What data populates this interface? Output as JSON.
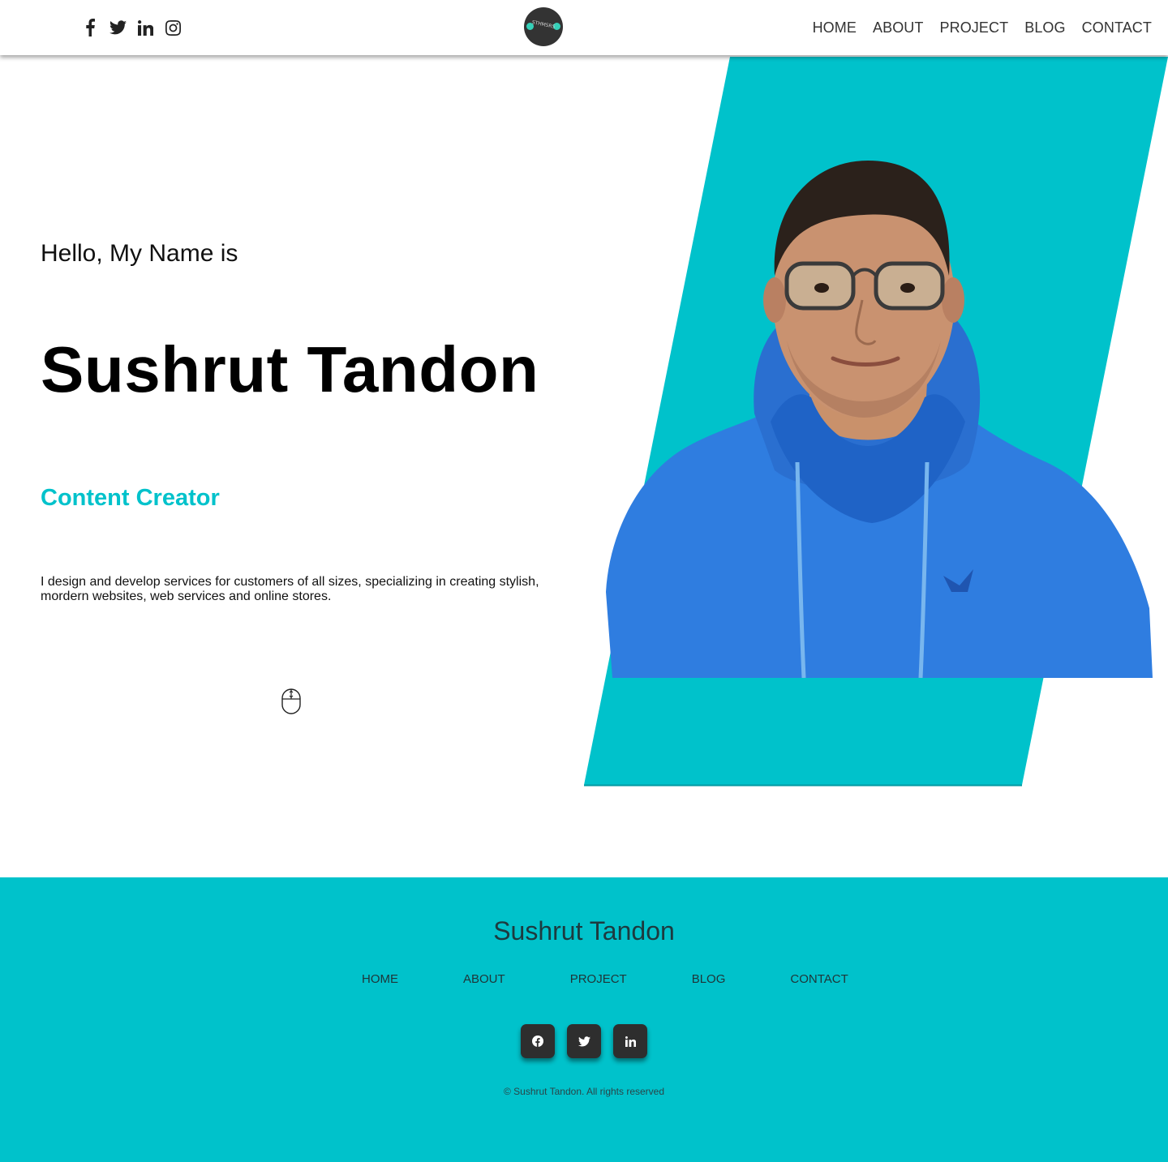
{
  "header": {
    "social": [
      {
        "icon": "facebook-icon"
      },
      {
        "icon": "twitter-icon"
      },
      {
        "icon": "linkedin-icon"
      },
      {
        "icon": "instagram-icon"
      }
    ],
    "logo_text": "STHMSRS",
    "nav": [
      "HOME",
      "ABOUT",
      "PROJECT",
      "BLOG",
      "CONTACT"
    ]
  },
  "hero": {
    "greeting": "Hello, My Name is",
    "name": "Sushrut Tandon",
    "role": "Content Creator",
    "description": "I design and develop services for customers of all sizes, specializing in creating stylish, mordern websites, web services and online stores.",
    "scroll_icon": "mouse-scroll-icon"
  },
  "footer": {
    "title": "Sushrut Tandon",
    "nav": [
      "HOME",
      "ABOUT",
      "PROJECT",
      "BLOG",
      "CONTACT"
    ],
    "social": [
      {
        "icon": "facebook-icon"
      },
      {
        "icon": "twitter-icon"
      },
      {
        "icon": "linkedin-icon"
      }
    ],
    "copyright": "© Sushrut Tandon. All rights reserved"
  },
  "colors": {
    "accent": "#00c2cb",
    "dark": "#2e2e2e",
    "logo_dot": "#35d0b8",
    "hoodie": "#2f7de0"
  }
}
